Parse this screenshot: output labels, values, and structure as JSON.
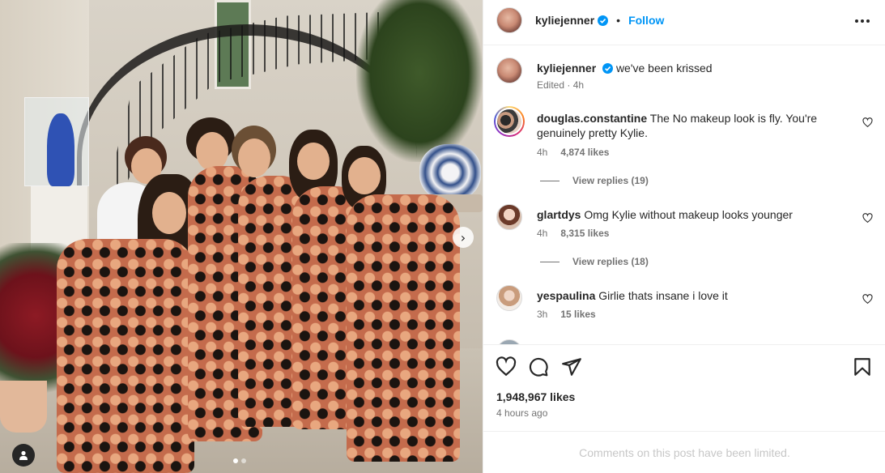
{
  "post": {
    "username": "kyliejenner",
    "follow_label": "Follow",
    "separator": "•",
    "caption": "we've been krissed",
    "caption_meta": "Edited · 4h"
  },
  "comments": [
    {
      "username": "douglas.constantine",
      "text": "The No makeup look is fly. You're genuinely pretty Kylie.",
      "time": "4h",
      "likes": "4,874 likes",
      "replies": "View replies (19)"
    },
    {
      "username": "glartdys",
      "text": "Omg Kylie without makeup looks younger",
      "time": "4h",
      "likes": "8,315 likes",
      "replies": "View replies (18)"
    },
    {
      "username": "yespaulina",
      "text": "Girlie thats insane i love it",
      "time": "3h",
      "likes": "15 likes"
    }
  ],
  "footer": {
    "likes_total": "1,948,967 likes",
    "time_ago": "4 hours ago",
    "limited_notice": "Comments on this post have been limited."
  },
  "carousel": {
    "current_slide": 1,
    "total_slides": 2
  },
  "icons": {
    "like": "heart-icon",
    "comment": "comment-icon",
    "share": "share-icon",
    "save": "bookmark-icon",
    "more": "more-options-icon",
    "next": "chevron-right-icon",
    "tag": "user-tag-icon",
    "verified": "verified-badge-icon"
  },
  "colors": {
    "accent": "#0095f6",
    "text": "#262626",
    "muted": "#737373",
    "verified": "#0095f6"
  }
}
